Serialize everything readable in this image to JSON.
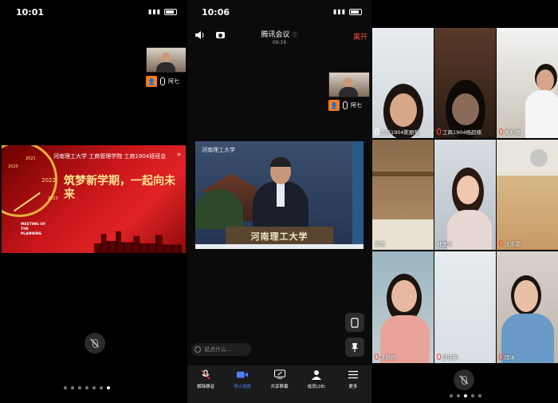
{
  "panel1": {
    "status_time": "10:01",
    "self_view": {
      "name": "阿七",
      "avatar_initial": ""
    },
    "slide": {
      "heading": "河南理工大学   工商管理学院   工商1904班班会",
      "title": "筑梦新学期，一起向未来",
      "subtitle_en": "MEETING OF THE PLANNING",
      "years": [
        "2020",
        "2021",
        "2022",
        "2023"
      ]
    },
    "mic_icon": "mic-off-icon",
    "page_dots": 7,
    "active_dot": 0
  },
  "panel2": {
    "status_time": "10:06",
    "meeting": {
      "title": "腾讯会议",
      "elapsed": "09:16",
      "leave_label": "离开"
    },
    "self_view": {
      "name": "阿七"
    },
    "video": {
      "school_logo_text": "河南理工大学",
      "desk_sign": "河南理工大学"
    },
    "chat_placeholder": "说点什么...",
    "toolbar": [
      {
        "id": "unmute",
        "label": "解除静音",
        "icon": "mic-off-icon"
      },
      {
        "id": "stop-video",
        "label": "停止视频",
        "icon": "video-camera-icon",
        "active": true
      },
      {
        "id": "share",
        "label": "共享屏幕",
        "icon": "screen-share-icon"
      },
      {
        "id": "members",
        "label": "成员(28)",
        "icon": "members-icon"
      },
      {
        "id": "more",
        "label": "更多",
        "icon": "more-icon"
      }
    ]
  },
  "panel3": {
    "participants": [
      {
        "name": "工商1904陈丽菊",
        "muted": false
      },
      {
        "name": "工商1904杨超楠",
        "muted": true
      },
      {
        "name": "黄昕悦",
        "muted": true
      },
      {
        "name": "郭晴",
        "muted": false
      },
      {
        "name": "林思含",
        "muted": false
      },
      {
        "name": "沈浩雯",
        "muted": true
      },
      {
        "name": "李舒妍",
        "muted": true
      },
      {
        "name": "邵佳新",
        "muted": true
      },
      {
        "name": "陌冰",
        "muted": true
      }
    ],
    "page_dots": 5,
    "active_dot": 2
  },
  "colors": {
    "accent": "#4e7cff",
    "leave": "#ff4d3d",
    "avatar": "#ff7a1a",
    "slide_red": "#c7161a"
  }
}
